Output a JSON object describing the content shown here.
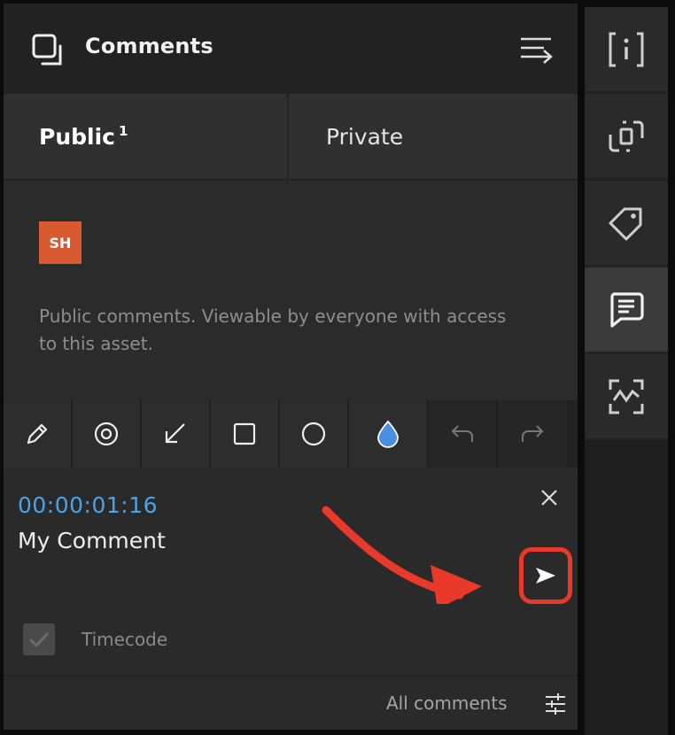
{
  "header": {
    "title": "Comments"
  },
  "tabs": [
    {
      "label": "Public",
      "count": "1"
    },
    {
      "label": "Private"
    }
  ],
  "comment_area": {
    "avatar_initials": "SH",
    "avatar_color": "#d75a30",
    "placeholder": "Public comments. Viewable by everyone with access to this asset."
  },
  "toolbar": {
    "tools": [
      "pencil-icon",
      "target-icon",
      "arrow-icon",
      "rectangle-icon",
      "circle-icon",
      "color-drop-icon",
      "undo-icon",
      "redo-icon"
    ],
    "color_value": "#4a90e2"
  },
  "editor": {
    "timecode": "00:00:01:16",
    "text": "My Comment",
    "timecode_label": "Timecode",
    "timecode_checked": true
  },
  "footer": {
    "all_comments_label": "All comments"
  },
  "colors": {
    "accent": "#4aa3e8",
    "annotation": "#e8392a",
    "panel": "#2b2b2b"
  }
}
